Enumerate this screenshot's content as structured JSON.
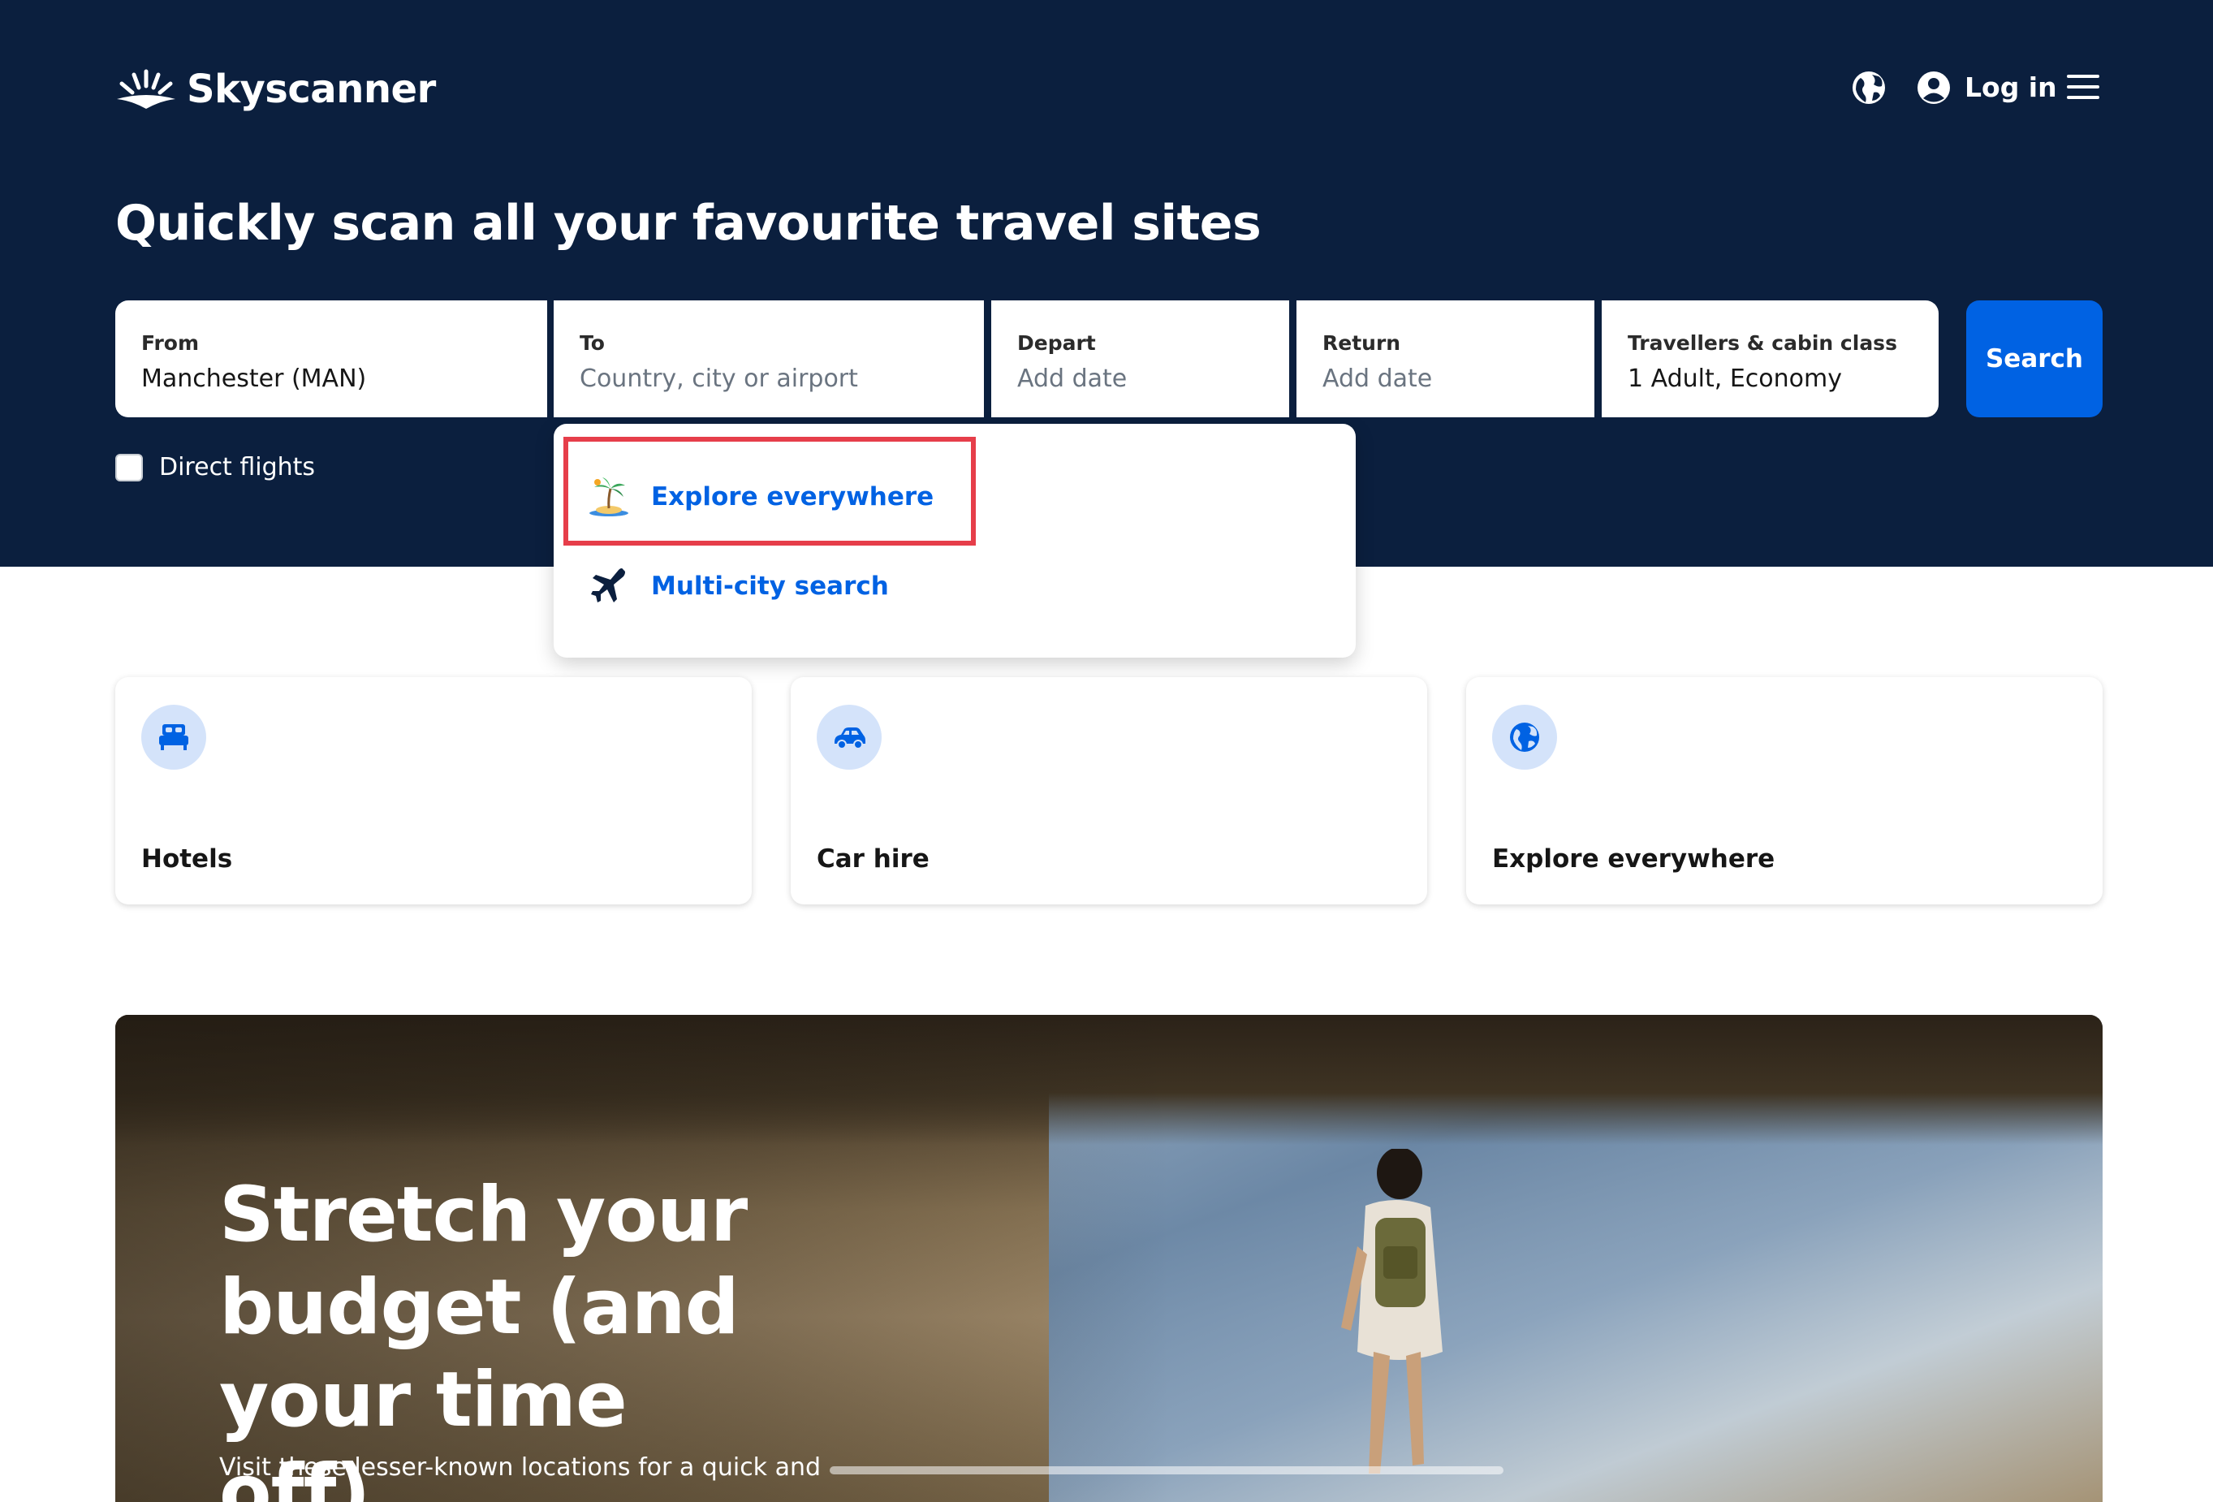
{
  "colors": {
    "header_bg": "#0b1f3e",
    "accent": "#0062e3",
    "highlight": "#e63e4a",
    "card_icon_bg": "#d4e3fa"
  },
  "header": {
    "logo_text": "Skyscanner",
    "login_label": "Log in",
    "icons": [
      "globe-icon",
      "user-icon",
      "menu-icon"
    ]
  },
  "hero": {
    "headline": "Quickly scan all your favourite travel sites"
  },
  "search": {
    "from": {
      "label": "From",
      "value": "Manchester (MAN)"
    },
    "to": {
      "label": "To",
      "placeholder": "Country, city or airport"
    },
    "depart": {
      "label": "Depart",
      "placeholder": "Add date"
    },
    "return": {
      "label": "Return",
      "placeholder": "Add date"
    },
    "travellers": {
      "label": "Travellers & cabin class",
      "value": "1 Adult, Economy"
    },
    "button_label": "Search",
    "direct_flights": {
      "label": "Direct flights",
      "checked": false
    }
  },
  "dropdown": {
    "items": [
      {
        "label": "Explore everywhere",
        "icon": "palm-island-icon"
      },
      {
        "label": "Multi-city search",
        "icon": "plane-icon"
      }
    ]
  },
  "cards": [
    {
      "label": "Hotels",
      "icon": "bed-icon"
    },
    {
      "label": "Car hire",
      "icon": "car-icon"
    },
    {
      "label": "Explore everywhere",
      "icon": "globe-icon"
    }
  ],
  "promo": {
    "title": "Stretch your budget (and your time off)",
    "subtitle": "Visit these lesser-known locations for a quick and"
  }
}
